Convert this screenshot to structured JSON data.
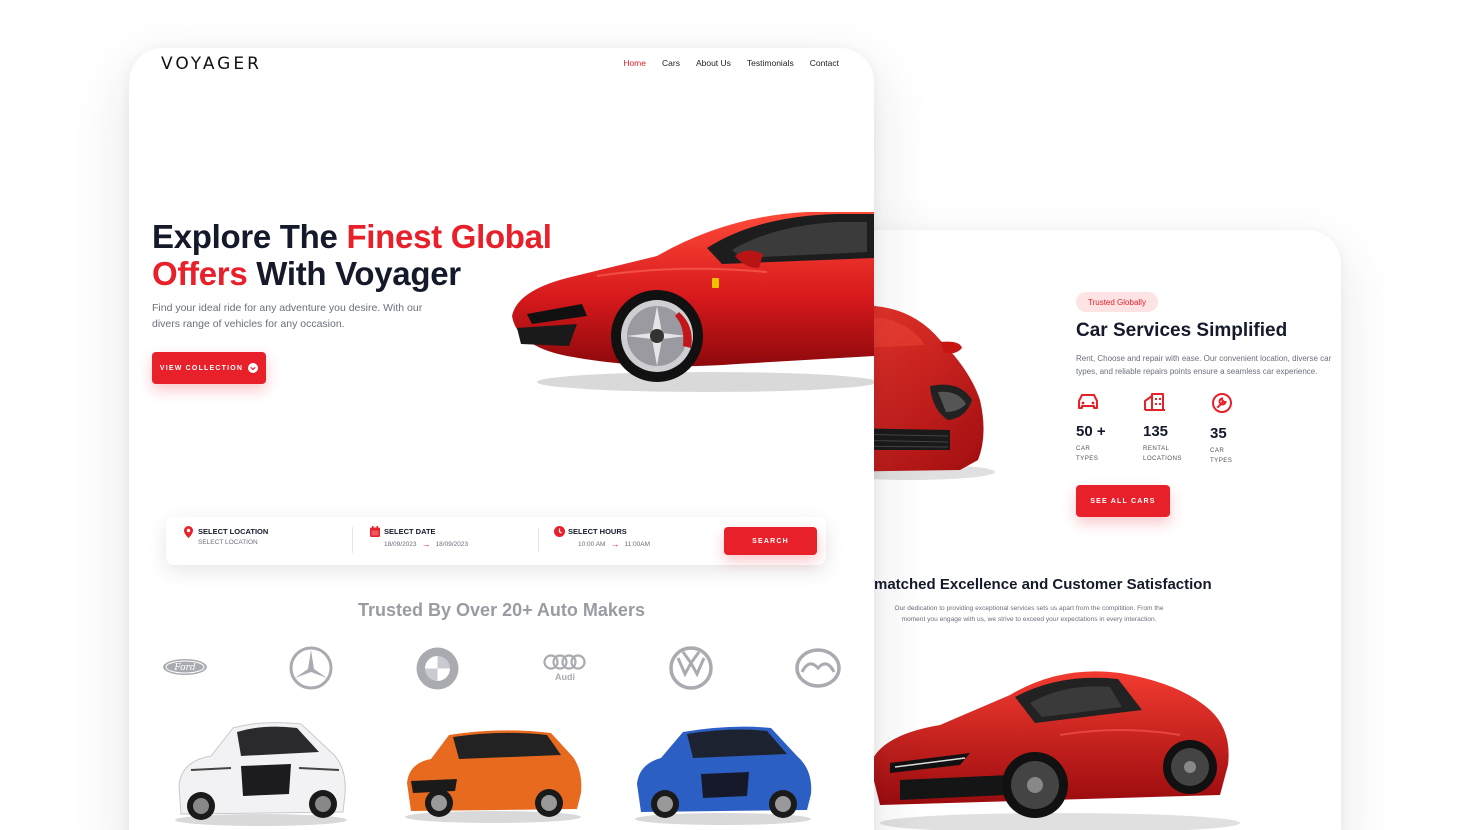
{
  "brand": {
    "logo": "VOYAGER"
  },
  "nav": {
    "items": [
      "Home",
      "Cars",
      "About Us",
      "Testimonials",
      "Contact"
    ],
    "active": "Home"
  },
  "hero": {
    "title_part1": "Explore The ",
    "title_highlight1": "Finest Global",
    "title_highlight2": "Offers",
    "title_part2": " With Voyager",
    "subtitle": "Find your ideal ride for any adventure you desire. With our divers range of vehicles for any occasion.",
    "cta": "VIEW COLLECTION"
  },
  "search": {
    "location_label": "SELECT LOCATION",
    "location_value": "SELECT LOCATION",
    "date_label": "SELECT DATE",
    "date_from": "18/09/2023",
    "date_to": "18/09/2023",
    "hours_label": "SELECT HOURS",
    "hours_from": "10:00 AM",
    "hours_to": "11:00AM",
    "button": "SEARCH"
  },
  "trusted": {
    "title": "Trusted By Over 20+ Auto Makers",
    "brands": [
      "ford-logo",
      "mercedes-logo",
      "bmw-logo",
      "audi-logo",
      "volkswagen-logo",
      "mazda-logo"
    ],
    "ford_text": "Ford",
    "audi_text": "Audi"
  },
  "services": {
    "pill": "Trusted Globally",
    "title": "Car Services Simplified",
    "subtitle": "Rent, Choose and repair with ease. Our convenient location, diverse car types, and reliable repairs points ensure a seamless car experience.",
    "stats": [
      {
        "icon": "car-icon",
        "number": "50 +",
        "caption_line1": "CAR",
        "caption_line2": "TYPES"
      },
      {
        "icon": "building-icon",
        "number": "135",
        "caption_line1": "RENTAL",
        "caption_line2": "LOCATIONS"
      },
      {
        "icon": "wrench-icon",
        "number": "35",
        "caption_line1": "CAR",
        "caption_line2": "TYPES"
      }
    ],
    "cta": "SEE ALL CARS"
  },
  "excellence": {
    "title": "matched Excellence and Customer Satisfaction",
    "subtitle": "Our dedication to providing exceptional services sets us apart from the compitition. From the moment you engage with us, we strive to exceed your expectations in every interaction."
  },
  "colors": {
    "accent": "#e8202a",
    "dark": "#151a2b",
    "muted": "#6a6f7c",
    "logo_gray": "#9a9ca3"
  }
}
